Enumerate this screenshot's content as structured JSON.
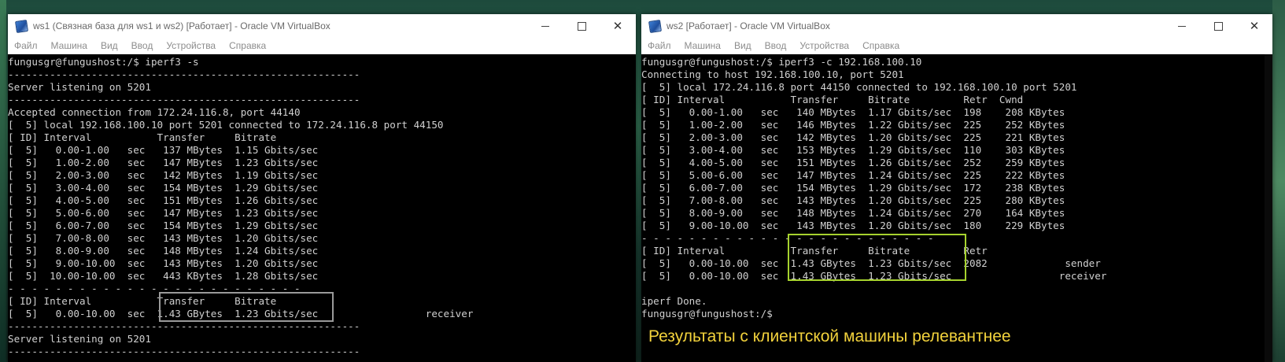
{
  "window1": {
    "title": "ws1 (Связная база для ws1 и ws2) [Работает] - Oracle VM VirtualBox",
    "menu": [
      "Файл",
      "Машина",
      "Вид",
      "Ввод",
      "Устройства",
      "Справка"
    ],
    "lines": [
      "fungusgr@fungushost:/$ iperf3 -s",
      "-----------------------------------------------------------",
      "Server listening on 5201",
      "-----------------------------------------------------------",
      "Accepted connection from 172.24.116.8, port 44140",
      "[  5] local 192.168.100.10 port 5201 connected to 172.24.116.8 port 44150",
      "[ ID] Interval           Transfer     Bitrate",
      "[  5]   0.00-1.00   sec   137 MBytes  1.15 Gbits/sec",
      "[  5]   1.00-2.00   sec   147 MBytes  1.23 Gbits/sec",
      "[  5]   2.00-3.00   sec   142 MBytes  1.19 Gbits/sec",
      "[  5]   3.00-4.00   sec   154 MBytes  1.29 Gbits/sec",
      "[  5]   4.00-5.00   sec   151 MBytes  1.26 Gbits/sec",
      "[  5]   5.00-6.00   sec   147 MBytes  1.23 Gbits/sec",
      "[  5]   6.00-7.00   sec   154 MBytes  1.29 Gbits/sec",
      "[  5]   7.00-8.00   sec   143 MBytes  1.20 Gbits/sec",
      "[  5]   8.00-9.00   sec   148 MBytes  1.24 Gbits/sec",
      "[  5]   9.00-10.00  sec   143 MBytes  1.20 Gbits/sec",
      "[  5]  10.00-10.00  sec   443 KBytes  1.28 Gbits/sec",
      "- - - - - - - - - - - - - - - - - - - - - - - - -",
      "[ ID] Interval           Transfer     Bitrate",
      "[  5]   0.00-10.00  sec  1.43 GBytes  1.23 Gbits/sec                  receiver",
      "-----------------------------------------------------------",
      "Server listening on 5201",
      "-----------------------------------------------------------"
    ]
  },
  "window2": {
    "title": "ws2 [Работает] - Oracle VM VirtualBox",
    "menu": [
      "Файл",
      "Машина",
      "Вид",
      "Ввод",
      "Устройства",
      "Справка"
    ],
    "lines": [
      "fungusgr@fungushost:/$ iperf3 -c 192.168.100.10",
      "Connecting to host 192.168.100.10, port 5201",
      "[  5] local 172.24.116.8 port 44150 connected to 192.168.100.10 port 5201",
      "[ ID] Interval           Transfer     Bitrate         Retr  Cwnd",
      "[  5]   0.00-1.00   sec   140 MBytes  1.17 Gbits/sec  198    208 KBytes",
      "[  5]   1.00-2.00   sec   146 MBytes  1.22 Gbits/sec  225    252 KBytes",
      "[  5]   2.00-3.00   sec   142 MBytes  1.20 Gbits/sec  225    221 KBytes",
      "[  5]   3.00-4.00   sec   153 MBytes  1.29 Gbits/sec  110    303 KBytes",
      "[  5]   4.00-5.00   sec   151 MBytes  1.26 Gbits/sec  252    259 KBytes",
      "[  5]   5.00-6.00   sec   147 MBytes  1.24 Gbits/sec  225    222 KBytes",
      "[  5]   6.00-7.00   sec   154 MBytes  1.29 Gbits/sec  172    238 KBytes",
      "[  5]   7.00-8.00   sec   143 MBytes  1.20 Gbits/sec  225    280 KBytes",
      "[  5]   8.00-9.00   sec   148 MBytes  1.24 Gbits/sec  270    164 KBytes",
      "[  5]   9.00-10.00  sec   143 MBytes  1.20 Gbits/sec  180    229 KBytes",
      "- - - - - - - - - - - - - - - - - - - - - - - - -",
      "[ ID] Interval           Transfer     Bitrate         Retr",
      "[  5]   0.00-10.00  sec  1.43 GBytes  1.23 Gbits/sec  2082             sender",
      "[  5]   0.00-10.00  sec  1.43 GBytes  1.23 Gbits/sec                  receiver",
      "",
      "iperf Done.",
      "fungusgr@fungushost:/$"
    ]
  },
  "annotation": "Результаты с клиентской машины релевантнее",
  "colors": {
    "box1": "#9a9a9a",
    "box2": "#a6d22e",
    "annotation": "#f2d23c"
  }
}
